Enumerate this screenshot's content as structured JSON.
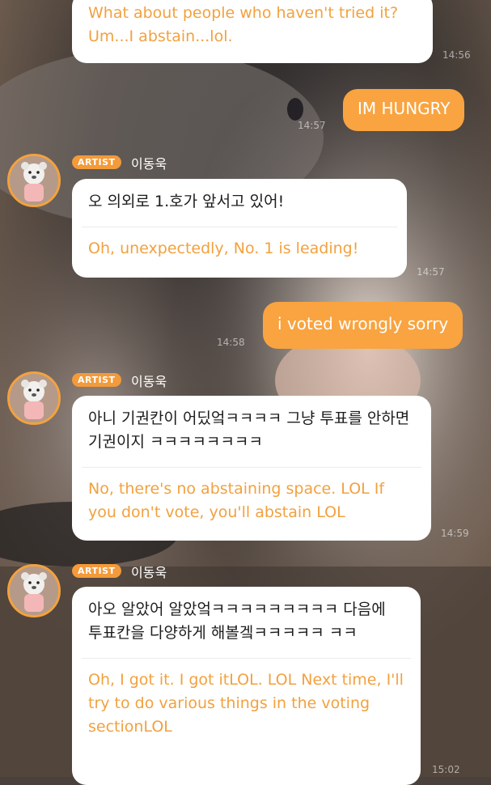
{
  "messages": [
    {
      "type": "incoming-partial",
      "translation": "What about people who haven't tried it? Um...I abstain...lol.",
      "time": "14:56"
    },
    {
      "type": "outgoing",
      "text": "IM HUNGRY",
      "time": "14:57"
    },
    {
      "type": "incoming",
      "badge": "ARTIST",
      "sender": "이동욱",
      "original": "오 의외로 1.호가 앞서고 있어!",
      "translation": "Oh, unexpectedly, No. 1 is leading!",
      "time": "14:57"
    },
    {
      "type": "outgoing",
      "text": "i voted wrongly sorry",
      "time": "14:58"
    },
    {
      "type": "incoming",
      "badge": "ARTIST",
      "sender": "이동욱",
      "original": "아니 기권칸이 어딨엌ㅋㅋㅋㅋ 그냥 투표를 안하면 기권이지 ㅋㅋㅋㅋㅋㅋㅋㅋ",
      "translation": "No, there's no abstaining space. LOL If you don't vote, you'll abstain LOL",
      "time": "14:59"
    },
    {
      "type": "incoming",
      "badge": "ARTIST",
      "sender": "이동욱",
      "original": "아오 알았어 알았엌ㅋㅋㅋㅋㅋㅋㅋㅋㅋ 다음에 투표칸을 다양하게 해볼겤ㅋㅋㅋㅋㅋ ㅋㅋ",
      "translation": "Oh, I got it. I got itLOL. LOL Next time, I'll try to do various things in the voting sectionLOL",
      "time": "15:02"
    }
  ],
  "colors": {
    "accent": "#f9a440",
    "translation_text": "#f2a13f",
    "bubble": "#ffffff",
    "badge": "#f39a3a"
  },
  "icons": {
    "avatar": "plush-bear-avatar-icon"
  }
}
